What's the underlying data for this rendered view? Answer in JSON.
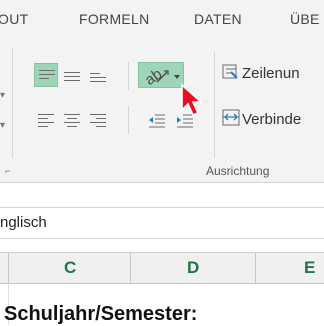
{
  "tabs": [
    "OUT",
    "FORMELN",
    "DATEN",
    "ÜBE"
  ],
  "ribbon": {
    "wrap_text_label": "Zeilenun",
    "merge_label": "Verbinde",
    "group_label": "Ausrichtung"
  },
  "formula_bar": {
    "value": "nglisch"
  },
  "columns": [
    "C",
    "D",
    "E"
  ],
  "cell": {
    "text": "Schuljahr/Semester:"
  },
  "colors": {
    "accent": "#217346",
    "selected": "#9fd5b7",
    "cursor": "#e81123"
  }
}
